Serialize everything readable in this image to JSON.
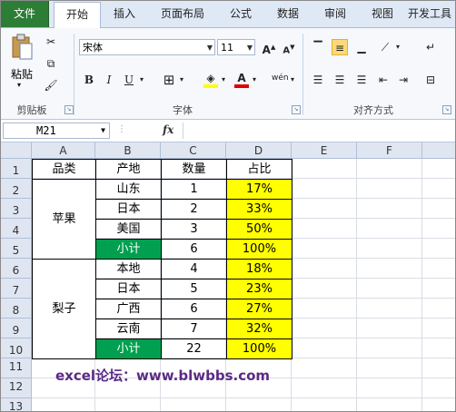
{
  "tabs": [
    "文件",
    "开始",
    "插入",
    "页面布局",
    "公式",
    "数据",
    "审阅",
    "视图",
    "开发工具"
  ],
  "active_tab": "开始",
  "clipboard": {
    "paste_label": "粘贴",
    "group_label": "剪贴板"
  },
  "font": {
    "name": "宋体",
    "size": "11",
    "group_label": "字体",
    "bold": "B",
    "italic": "I",
    "underline": "U"
  },
  "alignment": {
    "group_label": "对齐方式"
  },
  "formula_bar": {
    "name_box": "M21",
    "fx": "fx",
    "formula": ""
  },
  "columns": [
    "A",
    "B",
    "C",
    "D",
    "E",
    "F"
  ],
  "rows": [
    "1",
    "2",
    "3",
    "4",
    "5",
    "6",
    "7",
    "8",
    "9",
    "10",
    "11",
    "12",
    "13"
  ],
  "table": {
    "headers": [
      "品类",
      "产地",
      "数量",
      "占比"
    ],
    "groups": [
      {
        "category": "苹果",
        "items": [
          {
            "origin": "山东",
            "qty": "1",
            "pct": "17%"
          },
          {
            "origin": "日本",
            "qty": "2",
            "pct": "33%"
          },
          {
            "origin": "美国",
            "qty": "3",
            "pct": "50%"
          },
          {
            "origin": "小计",
            "qty": "6",
            "pct": "100%"
          }
        ]
      },
      {
        "category": "梨子",
        "items": [
          {
            "origin": "本地",
            "qty": "4",
            "pct": "18%"
          },
          {
            "origin": "日本",
            "qty": "5",
            "pct": "23%"
          },
          {
            "origin": "广西",
            "qty": "6",
            "pct": "27%"
          },
          {
            "origin": "云南",
            "qty": "7",
            "pct": "32%"
          },
          {
            "origin": "小计",
            "qty": "22",
            "pct": "100%"
          }
        ]
      }
    ]
  },
  "watermark": "excel论坛：www.blwbbs.com",
  "colors": {
    "highlight": "#ffff00",
    "subtotal": "#00a050",
    "file_tab": "#2c7d35"
  }
}
